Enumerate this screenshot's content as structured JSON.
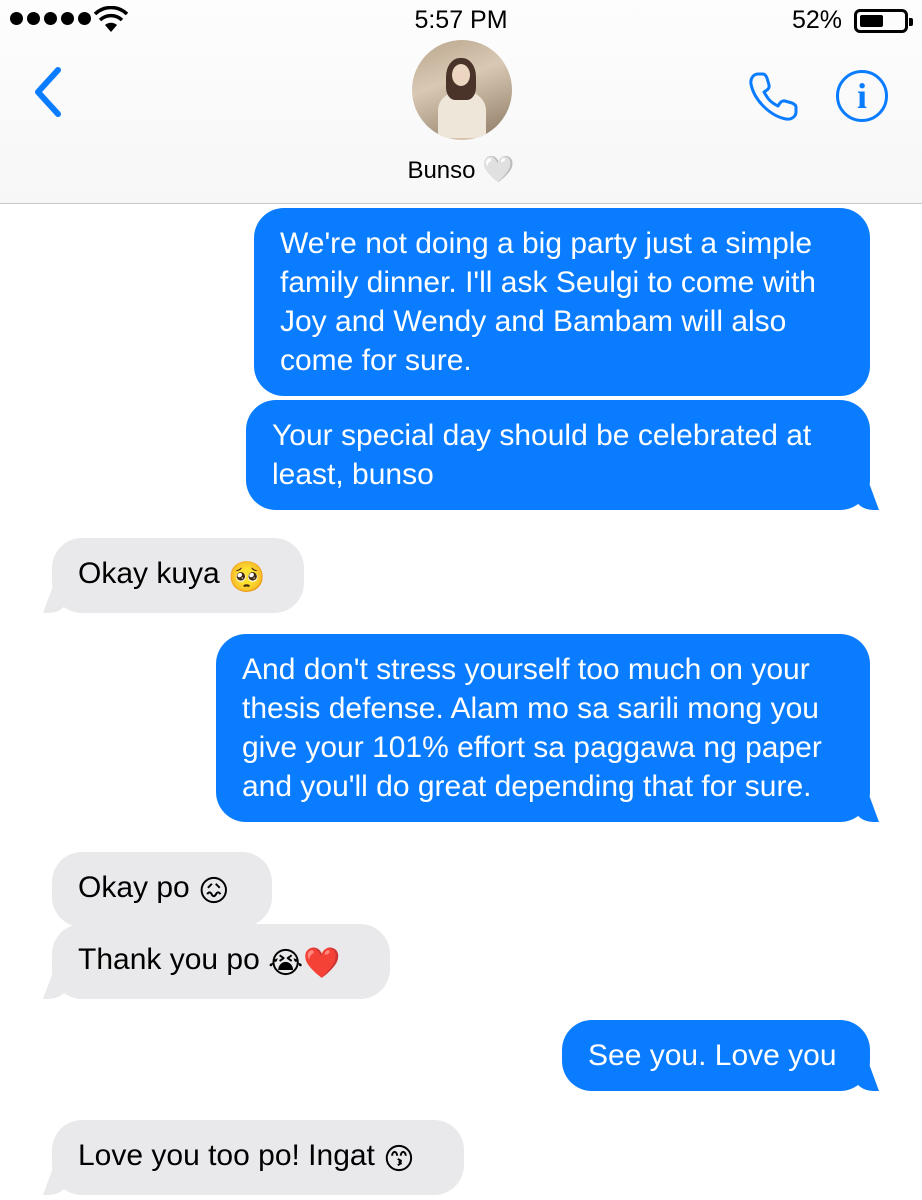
{
  "status_bar": {
    "time": "5:57 PM",
    "battery_percent": "52%",
    "battery_level": 0.52,
    "signal_bars": 5
  },
  "header": {
    "contact_name": "Bunso",
    "contact_name_emoji": "🤍",
    "back_icon": "chevron-left-icon",
    "call_icon": "phone-icon",
    "info_icon": "info-icon",
    "info_glyph": "i"
  },
  "colors": {
    "sent_bubble": "#0a7cff",
    "received_bubble": "#e9e9eb",
    "accent": "#0a7cff"
  },
  "messages": [
    {
      "direction": "sent",
      "text": "We're not doing a big party just a simple family dinner. I'll ask Seulgi to come with Joy and Wendy and Bambam will also come for sure."
    },
    {
      "direction": "sent",
      "text": "Your special day should be celebrated at least, bunso"
    },
    {
      "direction": "received",
      "text": "Okay kuya",
      "emoji": "🥺"
    },
    {
      "direction": "sent",
      "text": "And don't stress yourself too much on your thesis defense. Alam mo sa sarili mong you give your 101% effort sa paggawa ng paper and you'll do great depending that for sure."
    },
    {
      "direction": "received",
      "text": "Okay po",
      "emoji": "😖"
    },
    {
      "direction": "received",
      "text": "Thank you po",
      "emoji": "😭❤️"
    },
    {
      "direction": "sent",
      "text": "See you. Love you"
    },
    {
      "direction": "received",
      "text": "Love you too po! Ingat",
      "emoji": "😙"
    }
  ]
}
